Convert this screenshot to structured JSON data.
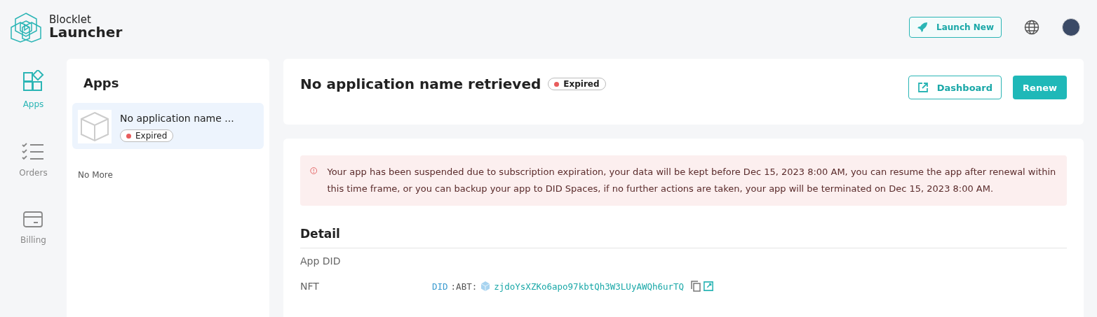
{
  "header": {
    "logo_top": "Blocklet",
    "logo_bottom": "Launcher",
    "launch_button": "Launch New"
  },
  "nav": [
    {
      "label": "Apps",
      "kind": "apps",
      "selected": true
    },
    {
      "label": "Orders",
      "kind": "orders",
      "selected": false
    },
    {
      "label": "Billing",
      "kind": "billing",
      "selected": false
    }
  ],
  "apps_panel": {
    "title": "Apps",
    "items": [
      {
        "name": "No application name ...",
        "status": "Expired",
        "color": "#e85c5c",
        "selected": true
      }
    ],
    "footer": "No More"
  },
  "app": {
    "title": "No application name retrieved",
    "status": "Expired",
    "color": "#e85c5c",
    "dashboard_button": "Dashboard",
    "renew_button": "Renew"
  },
  "alert": "Your app has been suspended due to subscription expiration, your data will be kept before Dec 15, 2023 8:00 AM, you can resume the app after renewal within this time frame, or you can backup your app to DID Spaces, if no further actions are taken, your app will be terminated on Dec 15, 2023 8:00 AM.",
  "detail": {
    "title": "Detail",
    "rows": [
      {
        "label": "App DID"
      },
      {
        "label": "NFT",
        "prefix": "DID",
        "prefix2": ":ABT:",
        "value": "zjdoYsXZKo6apo97kbtQh3W3LUyAWQh6urTQ"
      }
    ]
  }
}
